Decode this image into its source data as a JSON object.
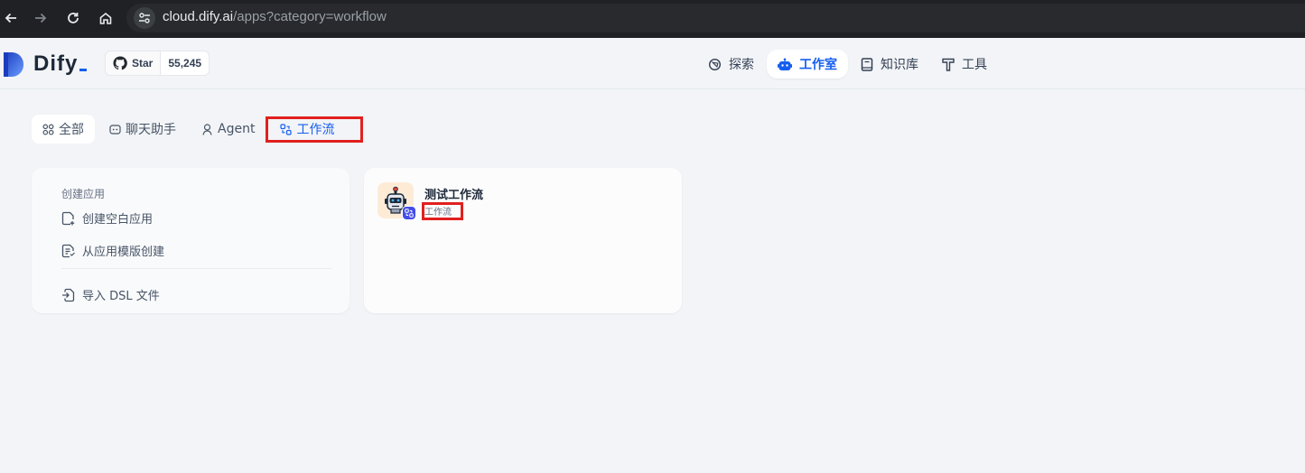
{
  "browser": {
    "url_host": "cloud.dify.ai",
    "url_path": "/apps?category=workflow",
    "back_icon": "arrow-left-icon",
    "forward_icon": "arrow-right-icon",
    "reload_icon": "reload-icon",
    "home_icon": "home-icon"
  },
  "header": {
    "logo_text": "Dify",
    "github": {
      "label": "Star",
      "count": "55,245"
    },
    "nav": [
      {
        "label": "探索",
        "icon": "compass-icon",
        "active": false
      },
      {
        "label": "工作室",
        "icon": "robot-icon",
        "active": true
      },
      {
        "label": "知识库",
        "icon": "book-icon",
        "active": false
      },
      {
        "label": "工具",
        "icon": "hammer-icon",
        "active": false
      }
    ]
  },
  "tabs": [
    {
      "label": "全部",
      "icon": "grid-icon"
    },
    {
      "label": "聊天助手",
      "icon": "chat-bot-icon"
    },
    {
      "label": "Agent",
      "icon": "agent-icon"
    },
    {
      "label": "工作流",
      "icon": "workflow-icon"
    }
  ],
  "create_card": {
    "title": "创建应用",
    "items": [
      {
        "label": "创建空白应用",
        "icon": "file-plus-icon"
      },
      {
        "label": "从应用模版创建",
        "icon": "file-template-icon"
      },
      {
        "label": "导入 DSL 文件",
        "icon": "file-import-icon"
      }
    ]
  },
  "apps": [
    {
      "name": "测试工作流",
      "type": "工作流",
      "icon": "robot-avatar-icon",
      "badge_icon": "workflow-badge-icon"
    }
  ],
  "colors": {
    "accent": "#155eef",
    "highlight": "#e0201f",
    "badge": "#444ce7",
    "app_icon_bg": "#fdebd6"
  }
}
